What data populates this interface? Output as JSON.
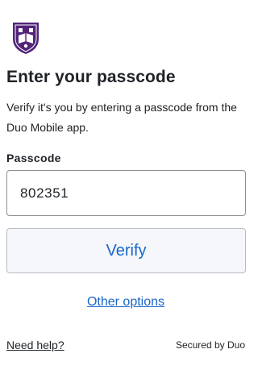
{
  "logo": {
    "icon": "university-crest-icon",
    "shield_color": "#51247a",
    "accent_color": "#ffffff"
  },
  "heading": "Enter your passcode",
  "description": "Verify it's you by entering a passcode from the Duo Mobile app.",
  "passcode": {
    "label": "Passcode",
    "value": "802351"
  },
  "verify_button_label": "Verify",
  "other_options_label": "Other options",
  "footer": {
    "help_label": "Need help?",
    "secured_label": "Secured by Duo"
  },
  "colors": {
    "link": "#1a66c8",
    "text": "#1f2328",
    "button_bg": "#f5f7fa",
    "border": "#8f8f8f"
  }
}
